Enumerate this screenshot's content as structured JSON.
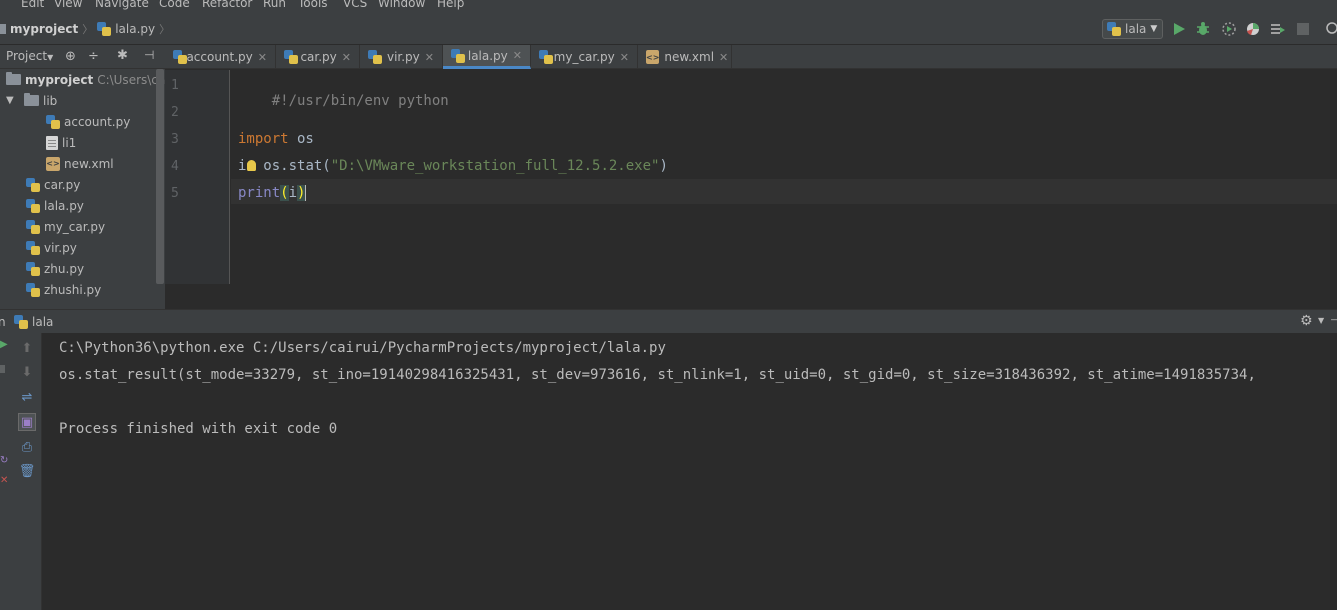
{
  "menu": [
    "Edit",
    "View",
    "Navigate",
    "Code",
    "Refactor",
    "Run",
    "Tools",
    "VCS",
    "Window",
    "Help"
  ],
  "breadcrumb": {
    "project": "myproject",
    "file": "lala.py"
  },
  "run_config": {
    "name": "lala"
  },
  "toolbar_icons": [
    "run-icon",
    "debug-icon",
    "coverage-icon",
    "profile-icon",
    "concurrency-icon",
    "stop-icon",
    "search-icon"
  ],
  "project_panel": {
    "title": "Project",
    "root_label": "myproject",
    "root_path": "C:\\Users\\cai",
    "lib_folder": "lib",
    "lib_files": [
      "account.py",
      "li1",
      "new.xml"
    ],
    "files": [
      "car.py",
      "lala.py",
      "my_car.py",
      "vir.py",
      "zhu.py",
      "zhushi.py"
    ]
  },
  "tabs": [
    {
      "label": "account.py",
      "active": false,
      "icon": "python-file-icon"
    },
    {
      "label": "car.py",
      "active": false,
      "icon": "python-file-icon"
    },
    {
      "label": "vir.py",
      "active": false,
      "icon": "python-file-icon"
    },
    {
      "label": "lala.py",
      "active": true,
      "icon": "python-file-icon"
    },
    {
      "label": "my_car.py",
      "active": false,
      "icon": "python-file-icon"
    },
    {
      "label": "new.xml",
      "active": false,
      "icon": "xml-file-icon"
    }
  ],
  "editor": {
    "line_numbers": [
      "1",
      "2",
      "3",
      "4",
      "5"
    ],
    "line1": "#!/usr/bin/env python",
    "line3_kw": "import",
    "line3_rest": " os",
    "line4_pre": "i",
    "line4_mid": "= os.stat(",
    "line4_str": "\"D:\\VMware_workstation_full_12.5.2.exe\"",
    "line4_end": ")",
    "line5_fn": "print",
    "line5_open": "(",
    "line5_arg": "i",
    "line5_close": ")"
  },
  "run_panel": {
    "label": "lala",
    "lines": [
      "C:\\Python36\\python.exe C:/Users/cairui/PycharmProjects/myproject/lala.py",
      "os.stat_result(st_mode=33279, st_ino=19140298416325431, st_dev=973616, st_nlink=1, st_uid=0, st_gid=0, st_size=318436392, st_atime=1491835734,",
      "",
      "Process finished with exit code 0"
    ]
  },
  "colors": {
    "background": "#2b2b2b",
    "panel": "#3c3f41",
    "keyword": "#cc7832",
    "string": "#6a8759",
    "builtin": "#8888c6",
    "run_green": "#59a869"
  }
}
